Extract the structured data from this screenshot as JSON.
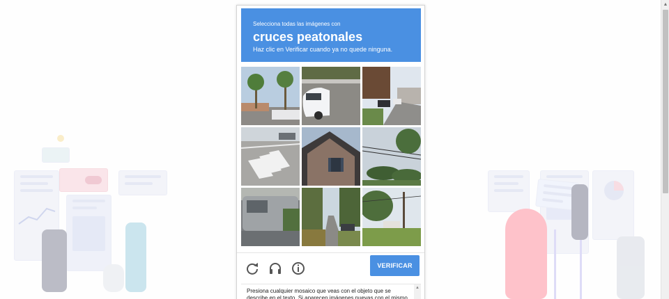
{
  "captcha": {
    "instruction_small": "Selecciona todas las imágenes con",
    "instruction_big": "cruces peatonales",
    "instruction_sub": "Haz clic en Verificar cuando ya no quede ninguna.",
    "verify_label": "VERIFICAR",
    "help_text": "Presiona cualquier mosaico que veas con el objeto que se describe en el texto. Si aparecen imágenes nuevas con el mismo objeto, presiónalas también. Cuando ya no veas",
    "accent_color": "#4a90e2",
    "tiles": [
      {
        "icon": "palm-trees-street-icon"
      },
      {
        "icon": "white-car-icon"
      },
      {
        "icon": "residential-street-icon"
      },
      {
        "icon": "crosswalk-icon"
      },
      {
        "icon": "house-roof-icon"
      },
      {
        "icon": "trees-powerlines-icon"
      },
      {
        "icon": "parked-vehicle-icon"
      },
      {
        "icon": "tree-lined-road-icon"
      },
      {
        "icon": "utility-pole-icon"
      }
    ],
    "controls": [
      "reload-icon",
      "audio-icon",
      "info-icon"
    ]
  }
}
